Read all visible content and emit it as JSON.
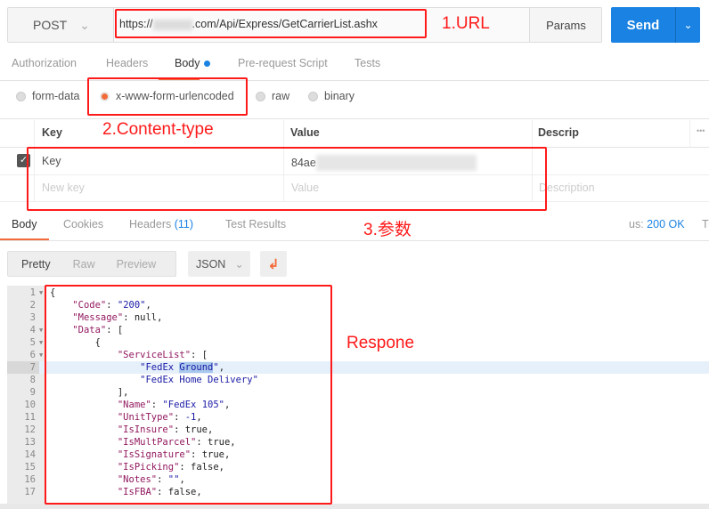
{
  "request": {
    "method": "POST",
    "url_prefix": "https://",
    "url_suffix": ".com/Api/Express/GetCarrierList.ashx",
    "params_label": "Params",
    "send_label": "Send"
  },
  "request_tabs": [
    "Authorization",
    "Headers",
    "Body",
    "Pre-request Script",
    "Tests"
  ],
  "body_types": [
    {
      "label": "form-data",
      "selected": false
    },
    {
      "label": "x-www-form-urlencoded",
      "selected": true
    },
    {
      "label": "raw",
      "selected": false
    },
    {
      "label": "binary",
      "selected": false
    }
  ],
  "table": {
    "headers": [
      "Key",
      "Value",
      "Descrip"
    ],
    "more": "•••",
    "rows": [
      {
        "checked": true,
        "key": "Key",
        "value": "84ae"
      }
    ],
    "placeholders": {
      "key": "New key",
      "value": "Value",
      "description": "Description"
    }
  },
  "response_tabs": {
    "body": "Body",
    "cookies": "Cookies",
    "headers": "Headers",
    "headers_count": "(11)",
    "tests": "Test Results"
  },
  "status": {
    "label": "us:",
    "value": "200 OK",
    "extra": "Ti"
  },
  "view": {
    "modes": [
      "Pretty",
      "Raw",
      "Preview"
    ],
    "format": "JSON"
  },
  "annotations": {
    "url": "1.URL",
    "content_type": "2.Content-type",
    "params": "3.参数",
    "response": "Respone"
  },
  "colors": {
    "accent": "#f26b3a",
    "send": "#1a82e2",
    "annotation": "#ff1a1a"
  },
  "code_lines": [
    [
      [
        "p",
        "{"
      ]
    ],
    [
      [
        "p",
        "    "
      ],
      [
        "k",
        "\"Code\""
      ],
      [
        "p",
        ": "
      ],
      [
        "s",
        "\"200\""
      ],
      [
        "p",
        ","
      ]
    ],
    [
      [
        "p",
        "    "
      ],
      [
        "k",
        "\"Message\""
      ],
      [
        "p",
        ": null,"
      ]
    ],
    [
      [
        "p",
        "    "
      ],
      [
        "k",
        "\"Data\""
      ],
      [
        "p",
        ": ["
      ]
    ],
    [
      [
        "p",
        "        {"
      ]
    ],
    [
      [
        "p",
        "            "
      ],
      [
        "k",
        "\"ServiceList\""
      ],
      [
        "p",
        ": ["
      ]
    ],
    [
      [
        "p",
        "                "
      ],
      [
        "s",
        "\"FedEx "
      ],
      [
        "sel",
        "Ground"
      ],
      [
        "s",
        "\""
      ],
      [
        "p",
        ","
      ]
    ],
    [
      [
        "p",
        "                "
      ],
      [
        "s",
        "\"FedEx Home Delivery\""
      ]
    ],
    [
      [
        "p",
        "            ],"
      ]
    ],
    [
      [
        "p",
        "            "
      ],
      [
        "k",
        "\"Name\""
      ],
      [
        "p",
        ": "
      ],
      [
        "s",
        "\"FedEx 105\""
      ],
      [
        "p",
        ","
      ]
    ],
    [
      [
        "p",
        "            "
      ],
      [
        "k",
        "\"UnitType\""
      ],
      [
        "p",
        ": "
      ],
      [
        "n",
        "-1"
      ],
      [
        "p",
        ","
      ]
    ],
    [
      [
        "p",
        "            "
      ],
      [
        "k",
        "\"IsInsure\""
      ],
      [
        "p",
        ": true,"
      ]
    ],
    [
      [
        "p",
        "            "
      ],
      [
        "k",
        "\"IsMultParcel\""
      ],
      [
        "p",
        ": true,"
      ]
    ],
    [
      [
        "p",
        "            "
      ],
      [
        "k",
        "\"IsSignature\""
      ],
      [
        "p",
        ": true,"
      ]
    ],
    [
      [
        "p",
        "            "
      ],
      [
        "k",
        "\"IsPicking\""
      ],
      [
        "p",
        ": false,"
      ]
    ],
    [
      [
        "p",
        "            "
      ],
      [
        "k",
        "\"Notes\""
      ],
      [
        "p",
        ": "
      ],
      [
        "s",
        "\"\""
      ],
      [
        "p",
        ","
      ]
    ],
    [
      [
        "p",
        "            "
      ],
      [
        "k",
        "\"IsFBA\""
      ],
      [
        "p",
        ": false,"
      ]
    ]
  ],
  "fold_lines": [
    1,
    4,
    5,
    6
  ],
  "highlight_line": 7
}
